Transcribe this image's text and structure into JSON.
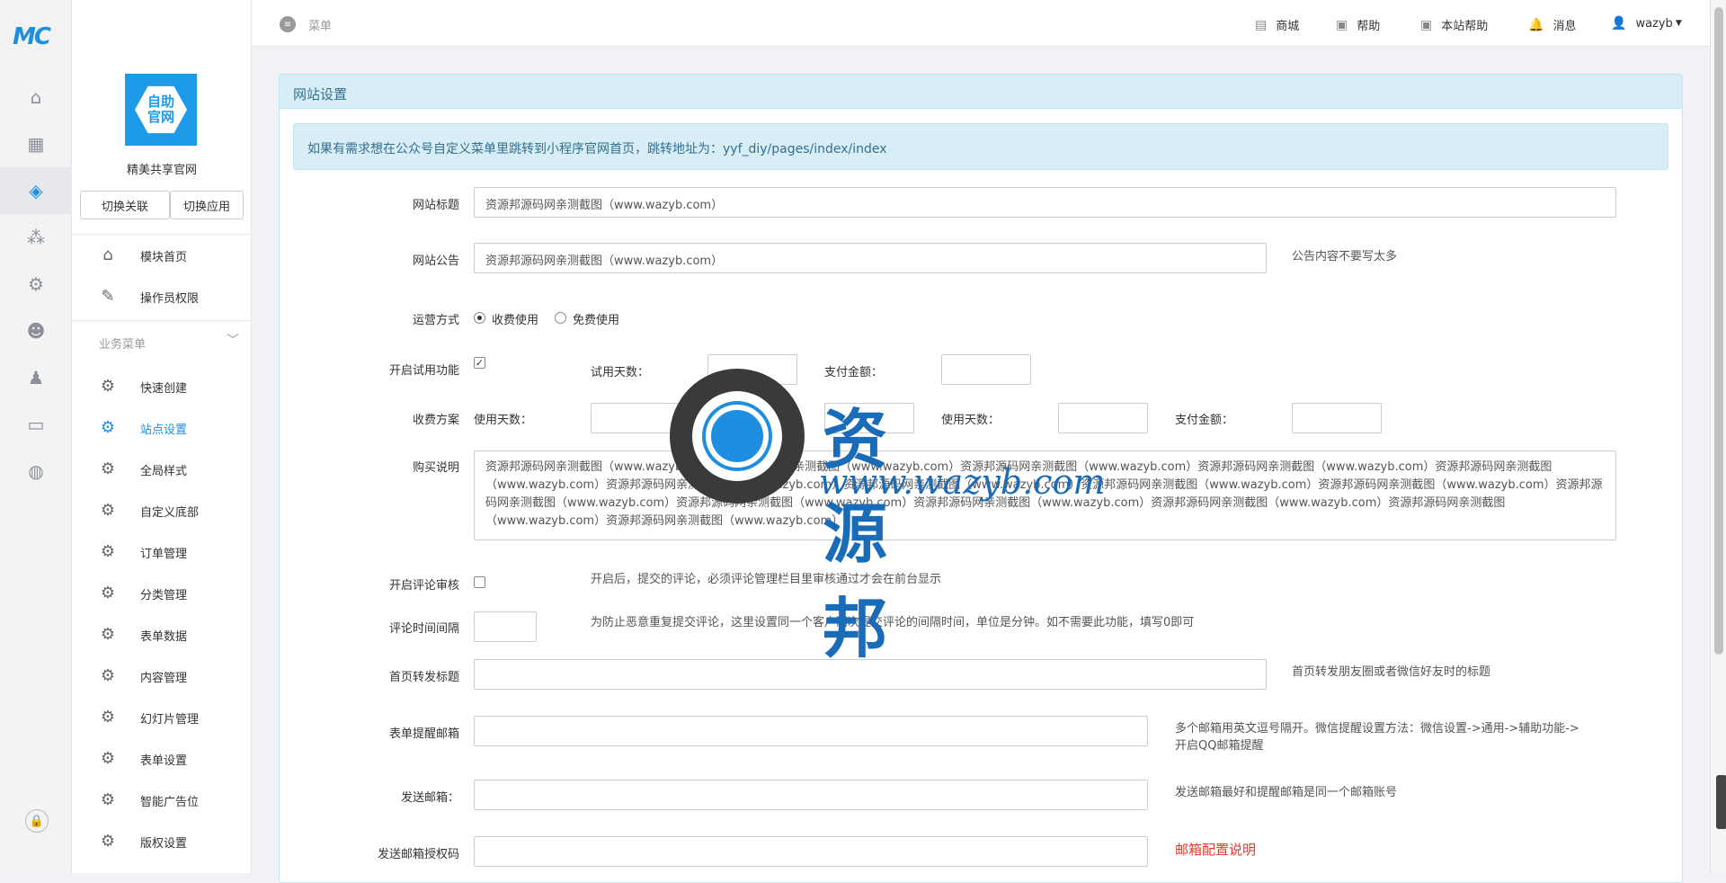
{
  "brand": {
    "logo_text": "MC"
  },
  "iconbar": [
    "home-icon",
    "apps-icon",
    "cube-icon",
    "modules-icon",
    "settings-icon",
    "users-icon",
    "admin-icon",
    "monitor-icon",
    "globe-icon"
  ],
  "sidebar": {
    "app_logo_text": "自助官网",
    "app_name": "精美共享官网",
    "switch_relation": "切换关联",
    "switch_app": "切换应用",
    "top_items": [
      {
        "label": "模块首页",
        "icon": "home-icon"
      },
      {
        "label": "操作员权限",
        "icon": "doc-edit-icon"
      }
    ],
    "group_label": "业务菜单",
    "items": [
      {
        "label": "快速创建"
      },
      {
        "label": "站点设置"
      },
      {
        "label": "全局样式"
      },
      {
        "label": "自定义底部"
      },
      {
        "label": "订单管理"
      },
      {
        "label": "分类管理"
      },
      {
        "label": "表单数据"
      },
      {
        "label": "内容管理"
      },
      {
        "label": "幻灯片管理"
      },
      {
        "label": "表单设置"
      },
      {
        "label": "智能广告位"
      },
      {
        "label": "版权设置"
      }
    ],
    "active_item": "站点设置"
  },
  "topbar": {
    "menu_label": "菜单",
    "links": [
      {
        "label": "商城",
        "icon": "store-icon"
      },
      {
        "label": "帮助",
        "icon": "help-icon"
      },
      {
        "label": "本站帮助",
        "icon": "site-help-icon"
      },
      {
        "label": "消息",
        "icon": "bell-icon"
      }
    ],
    "user": "wazyb"
  },
  "panel": {
    "title": "网站设置",
    "alert": "如果有需求想在公众号自定义菜单里跳转到小程序官网首页，跳转地址为：yyf_diy/pages/index/index",
    "site_title_label": "网站标题",
    "site_title_value": "资源邦源码网亲测截图（www.wazyb.com）",
    "notice_label": "网站公告",
    "notice_value": "资源邦源码网亲测截图（www.wazyb.com）",
    "notice_hint": "公告内容不要写太多",
    "mode_label": "运营方式",
    "mode_paid": "收费使用",
    "mode_free": "免费使用",
    "trial_label": "开启试用功能",
    "trial_days_label": "试用天数：",
    "pay_amount_label": "支付金额：",
    "plan_label": "收费方案",
    "use_days_label": "使用天数：",
    "pay_amount_label2": "支付金额：",
    "use_days_label2": "使用天数：",
    "pay_amount_label3": "支付金额：",
    "buy_label": "购买说明",
    "buy_value": "资源邦源码网亲测截图（www.wazyb.com）资源邦源码网亲测截图（www.wazyb.com）资源邦源码网亲测截图（www.wazyb.com）资源邦源码网亲测截图（www.wazyb.com）资源邦源码网亲测截图（www.wazyb.com）资源邦源码网亲测截图（www.wazyb.com）资源邦源码网亲测截图（www.wazyb.com）资源邦源码网亲测截图（www.wazyb.com）资源邦源码网亲测截图（www.wazyb.com）资源邦源码网亲测截图（www.wazyb.com）资源邦源码网亲测截图（www.wazyb.com）资源邦源码网亲测截图（www.wazyb.com）资源邦源码网亲测截图（www.wazyb.com）资源邦源码网亲测截图（www.wazyb.com）资源邦源码网亲测截图（www.wazyb.com）",
    "review_label": "开启评论审核",
    "review_hint": "开启后，提交的评论，必须评论管理栏目里审核通过才会在前台显示",
    "interval_label": "评论时间间隔",
    "interval_hint": "为防止恶意重复提交评论，这里设置同一个客户两次提交评论的间隔时间，单位是分钟。如不需要此功能，填写0即可",
    "share_title_label": "首页转发标题",
    "share_title_hint": "首页转发朋友圈或者微信好友时的标题",
    "form_mail_label": "表单提醒邮箱",
    "form_mail_hint_1": "多个邮箱用英文逗号隔开。微信提醒设置方法：微信设置->通用->辅助功能->",
    "form_mail_hint_2": "开启QQ邮箱提醒",
    "send_mail_label": "发送邮箱：",
    "send_mail_hint": "发送邮箱最好和提醒邮箱是同一个邮箱账号",
    "auth_code_label": "发送邮箱授权码",
    "auth_code_hint": "邮箱配置说明"
  },
  "watermark": {
    "title": "资源邦",
    "url": "www.wazyb.com"
  }
}
